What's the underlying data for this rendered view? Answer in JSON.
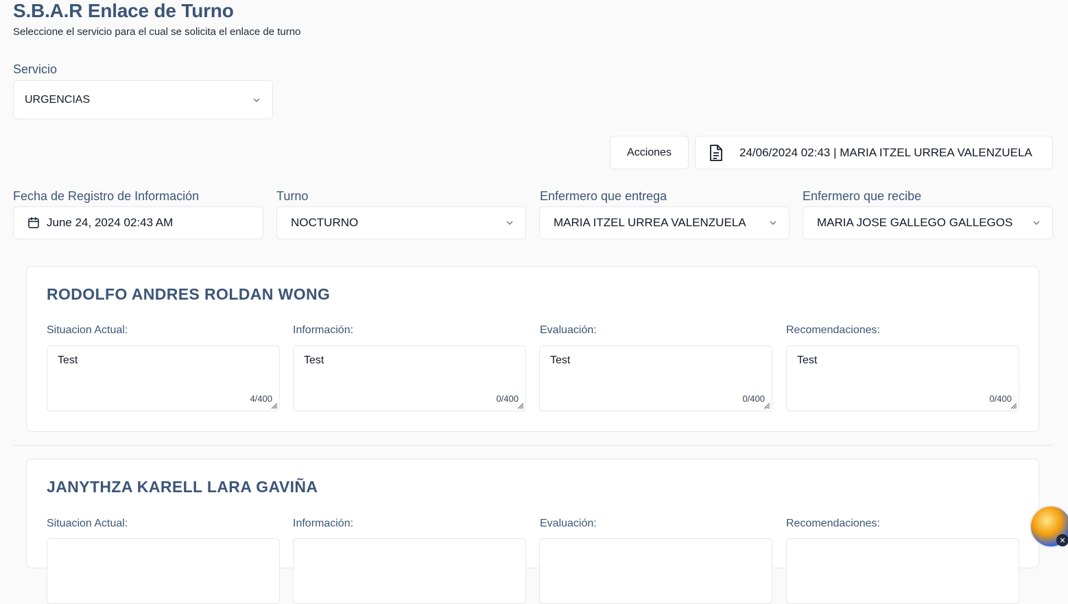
{
  "header": {
    "title": "S.B.A.R Enlace de Turno",
    "subtitle": "Seleccione el servicio para el cual se solicita el enlace de turno"
  },
  "servicio": {
    "label": "Servicio",
    "value": "URGENCIAS"
  },
  "toolbar": {
    "acciones_label": "Acciones",
    "record_label": "24/06/2024 02:43 | MARIA ITZEL URREA VALENZUELA",
    "record_icon": "document-icon"
  },
  "form": {
    "fecha": {
      "label": "Fecha de Registro de Información",
      "value": "June 24, 2024 02:43 AM"
    },
    "turno": {
      "label": "Turno",
      "value": "NOCTURNO"
    },
    "entrega": {
      "label": "Enfermero que entrega",
      "value": "MARIA ITZEL URREA VALENZUELA"
    },
    "recibe": {
      "label": "Enfermero que recibe",
      "value": "MARIA JOSE GALLEGO GALLEGOS"
    }
  },
  "patients": [
    {
      "name": "RODOLFO ANDRES ROLDAN WONG",
      "fields": [
        {
          "label": "Situacion Actual:",
          "value": "Test",
          "count": "4/400"
        },
        {
          "label": "Información:",
          "value": "Test",
          "count": "0/400"
        },
        {
          "label": "Evaluación:",
          "value": "Test",
          "count": "0/400"
        },
        {
          "label": "Recomendaciones:",
          "value": "Test",
          "count": "0/400"
        }
      ]
    },
    {
      "name": "JANYTHZA KARELL LARA GAVIÑA",
      "fields": [
        {
          "label": "Situacion Actual:"
        },
        {
          "label": "Información:"
        },
        {
          "label": "Evaluación:"
        },
        {
          "label": "Recomendaciones:"
        }
      ]
    }
  ],
  "colors": {
    "accent": "#3b5577",
    "border": "#e5e7eb",
    "background": "#fafafa"
  }
}
